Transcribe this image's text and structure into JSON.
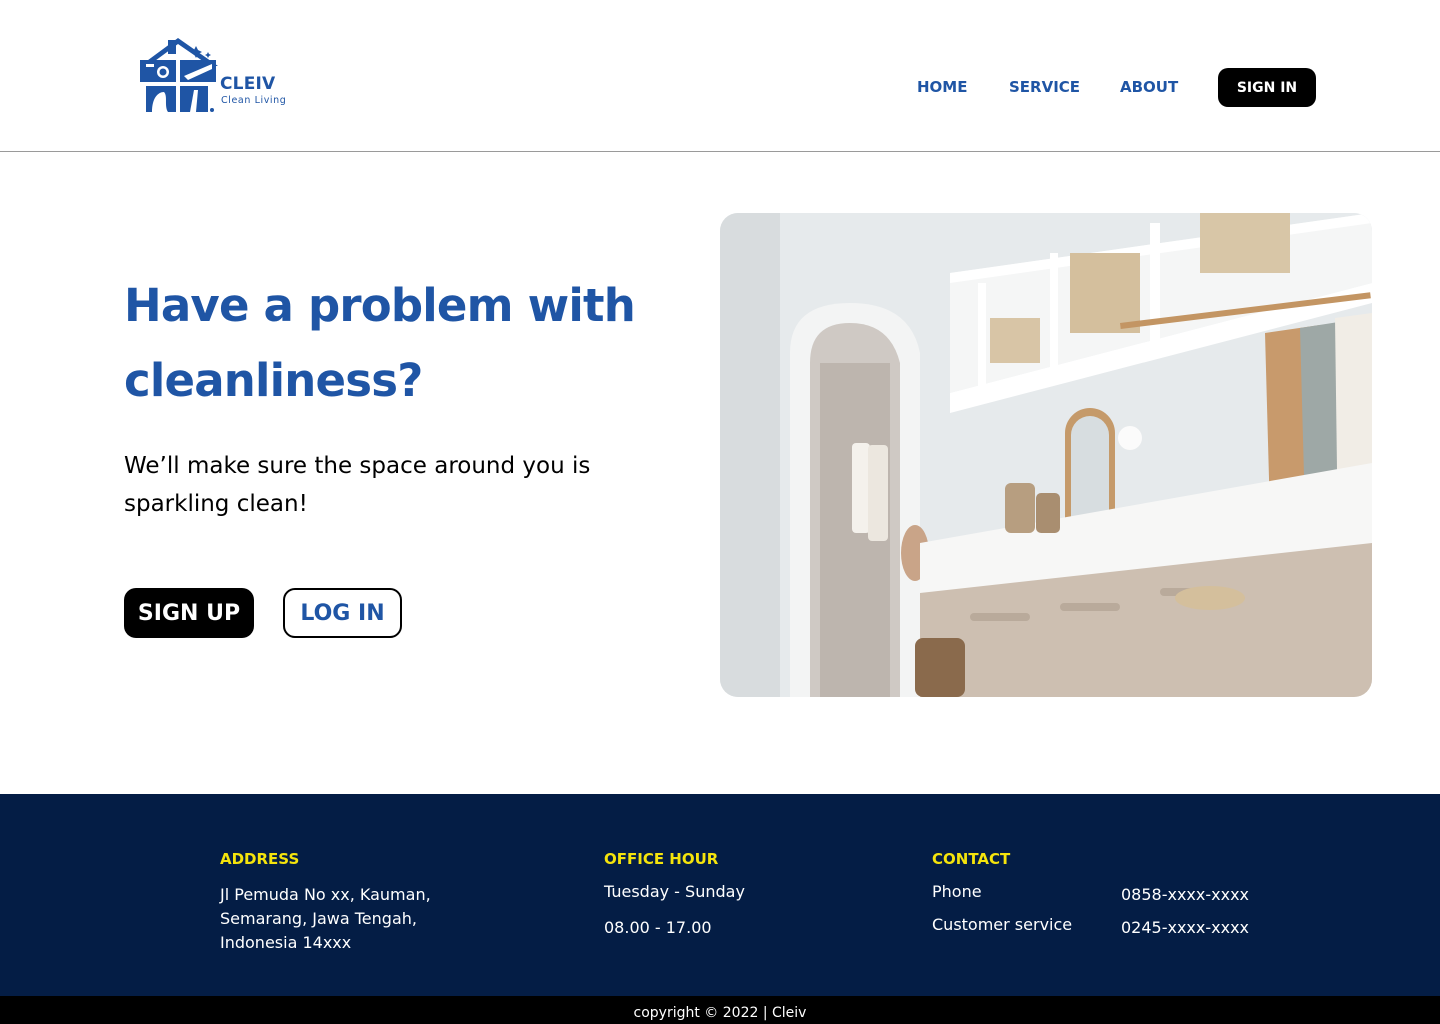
{
  "header": {
    "logo": {
      "name": "CLEIV",
      "tagline": "Clean Living",
      "icon": "house-cleaning-logo-icon"
    },
    "nav": [
      {
        "label": "HOME"
      },
      {
        "label": "SERVICE"
      },
      {
        "label": "ABOUT"
      }
    ],
    "signin_label": "SIGN IN"
  },
  "hero": {
    "title": "Have a problem with cleanliness?",
    "subtitle": "We’ll make sure the space around you is sparkling clean!",
    "signup_label": "SIGN UP",
    "login_label": "LOG IN",
    "image": "walk-in-closet-photo"
  },
  "footer": {
    "address": {
      "heading": "ADDRESS",
      "text": "Jl Pemuda  No xx, Kauman, Semarang, Jawa Tengah, Indonesia 14xxx"
    },
    "office_hour": {
      "heading": "OFFICE HOUR",
      "days": "Tuesday - Sunday",
      "hours": "08.00 - 17.00"
    },
    "contact": {
      "heading": "CONTACT",
      "rows": [
        {
          "label": "Phone",
          "value": "0858-xxxx-xxxx"
        },
        {
          "label": "Customer service",
          "value": "0245-xxxx-xxxx"
        }
      ]
    },
    "copyright": "copyright © 2022 | Cleiv"
  },
  "colors": {
    "brand_blue": "#1f55a5",
    "footer_navy": "#041d45",
    "footer_heading_yellow": "#f5e40c",
    "button_black": "#000000"
  }
}
